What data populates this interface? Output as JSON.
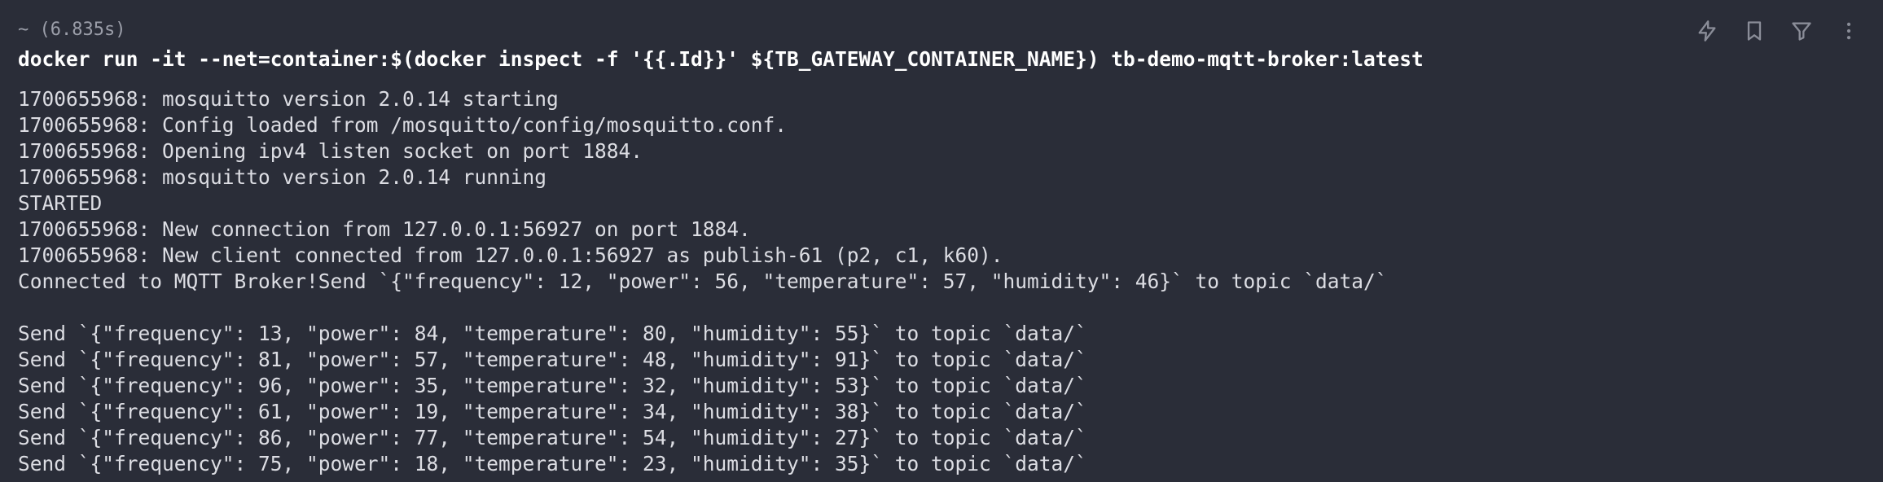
{
  "block": {
    "cwd": "~",
    "duration": "(6.835s)",
    "command": "docker run -it --net=container:$(docker inspect -f '{{.Id}}' ${TB_GATEWAY_CONTAINER_NAME}) tb-demo-mqtt-broker:latest",
    "output": [
      "1700655968: mosquitto version 2.0.14 starting",
      "1700655968: Config loaded from /mosquitto/config/mosquitto.conf.",
      "1700655968: Opening ipv4 listen socket on port 1884.",
      "1700655968: mosquitto version 2.0.14 running",
      "STARTED",
      "1700655968: New connection from 127.0.0.1:56927 on port 1884.",
      "1700655968: New client connected from 127.0.0.1:56927 as publish-61 (p2, c1, k60).",
      "Connected to MQTT Broker!Send `{\"frequency\": 12, \"power\": 56, \"temperature\": 57, \"humidity\": 46}` to topic `data/`",
      "",
      "Send `{\"frequency\": 13, \"power\": 84, \"temperature\": 80, \"humidity\": 55}` to topic `data/`",
      "Send `{\"frequency\": 81, \"power\": 57, \"temperature\": 48, \"humidity\": 91}` to topic `data/`",
      "Send `{\"frequency\": 96, \"power\": 35, \"temperature\": 32, \"humidity\": 53}` to topic `data/`",
      "Send `{\"frequency\": 61, \"power\": 19, \"temperature\": 34, \"humidity\": 38}` to topic `data/`",
      "Send `{\"frequency\": 86, \"power\": 77, \"temperature\": 54, \"humidity\": 27}` to topic `data/`",
      "Send `{\"frequency\": 75, \"power\": 18, \"temperature\": 23, \"humidity\": 35}` to topic `data/`"
    ]
  },
  "toolbar": {
    "icons": [
      "lightning-icon",
      "bookmark-icon",
      "filter-icon",
      "more-vertical-icon"
    ]
  },
  "colors": {
    "background": "#2a2d38",
    "command": "#ffffff",
    "output": "#dcdde3",
    "muted": "#9b9ea9",
    "icon": "#8a8d98"
  }
}
